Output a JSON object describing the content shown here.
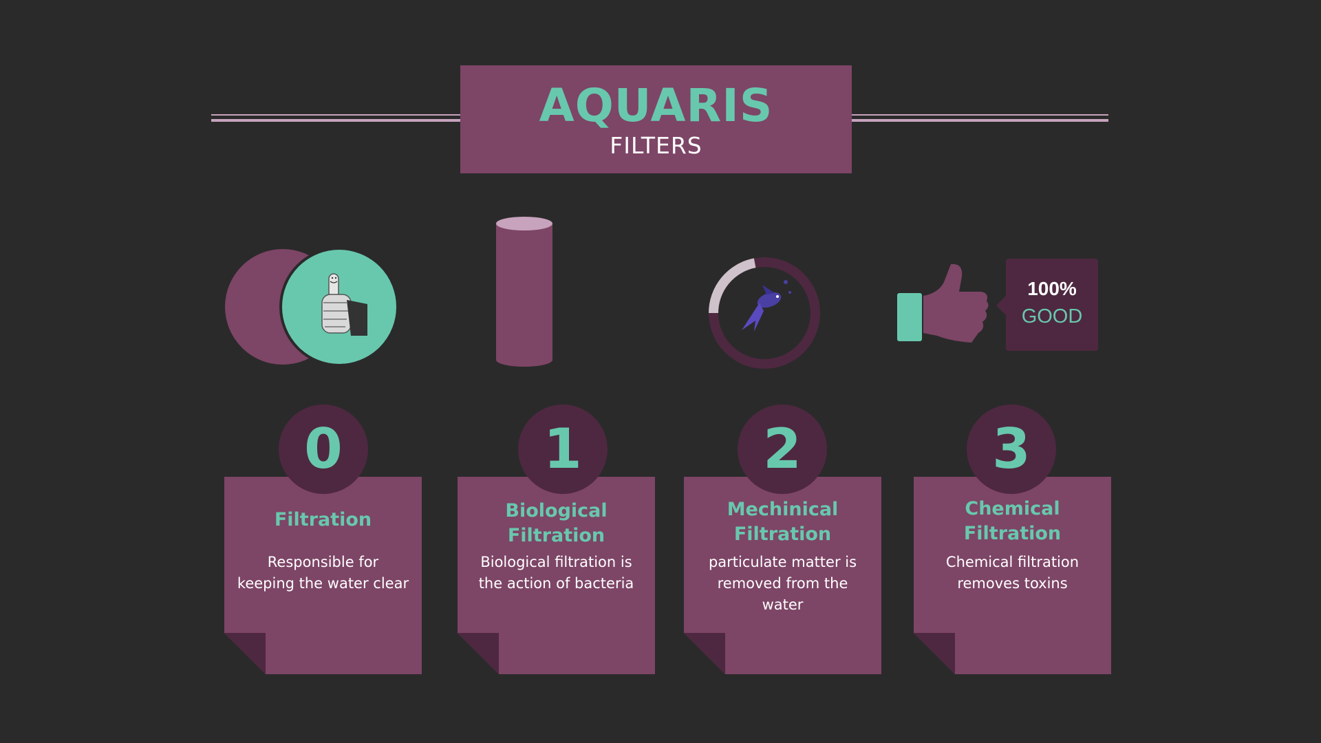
{
  "header": {
    "title": "AQUARIS",
    "subtitle": "FILTERS"
  },
  "callout": {
    "percent": "100%",
    "word": "GOOD"
  },
  "steps": [
    {
      "number": "0",
      "title_lines": [
        "Filtration"
      ],
      "desc_lines": [
        "Responsible for",
        "keeping the water clear"
      ]
    },
    {
      "number": "1",
      "title_lines": [
        "Biological",
        "Filtration"
      ],
      "desc_lines": [
        "Biological filtration is",
        "the action of bacteria"
      ]
    },
    {
      "number": "2",
      "title_lines": [
        "Mechinical",
        "Filtration"
      ],
      "desc_lines": [
        "particulate matter is",
        "removed from the",
        "water"
      ]
    },
    {
      "number": "3",
      "title_lines": [
        "Chemical",
        "Filtration"
      ],
      "desc_lines": [
        "Chemical filtration",
        "removes toxins"
      ]
    }
  ],
  "progress_ring": {
    "fraction": 0.22
  },
  "colors": {
    "background": "#2a2a2a",
    "purple": "#7d4566",
    "dark_purple": "#4e2840",
    "teal": "#68c8ad",
    "light_pink": "#c8a3bd"
  },
  "icons": {
    "venn": "overlapping-circles-icon",
    "cylinder": "cylinder-icon",
    "ring": "progress-ring-icon",
    "fish": "fish-icon",
    "thumb_photo": "thumbs-up-photo",
    "thumb": "thumbs-up-icon"
  }
}
